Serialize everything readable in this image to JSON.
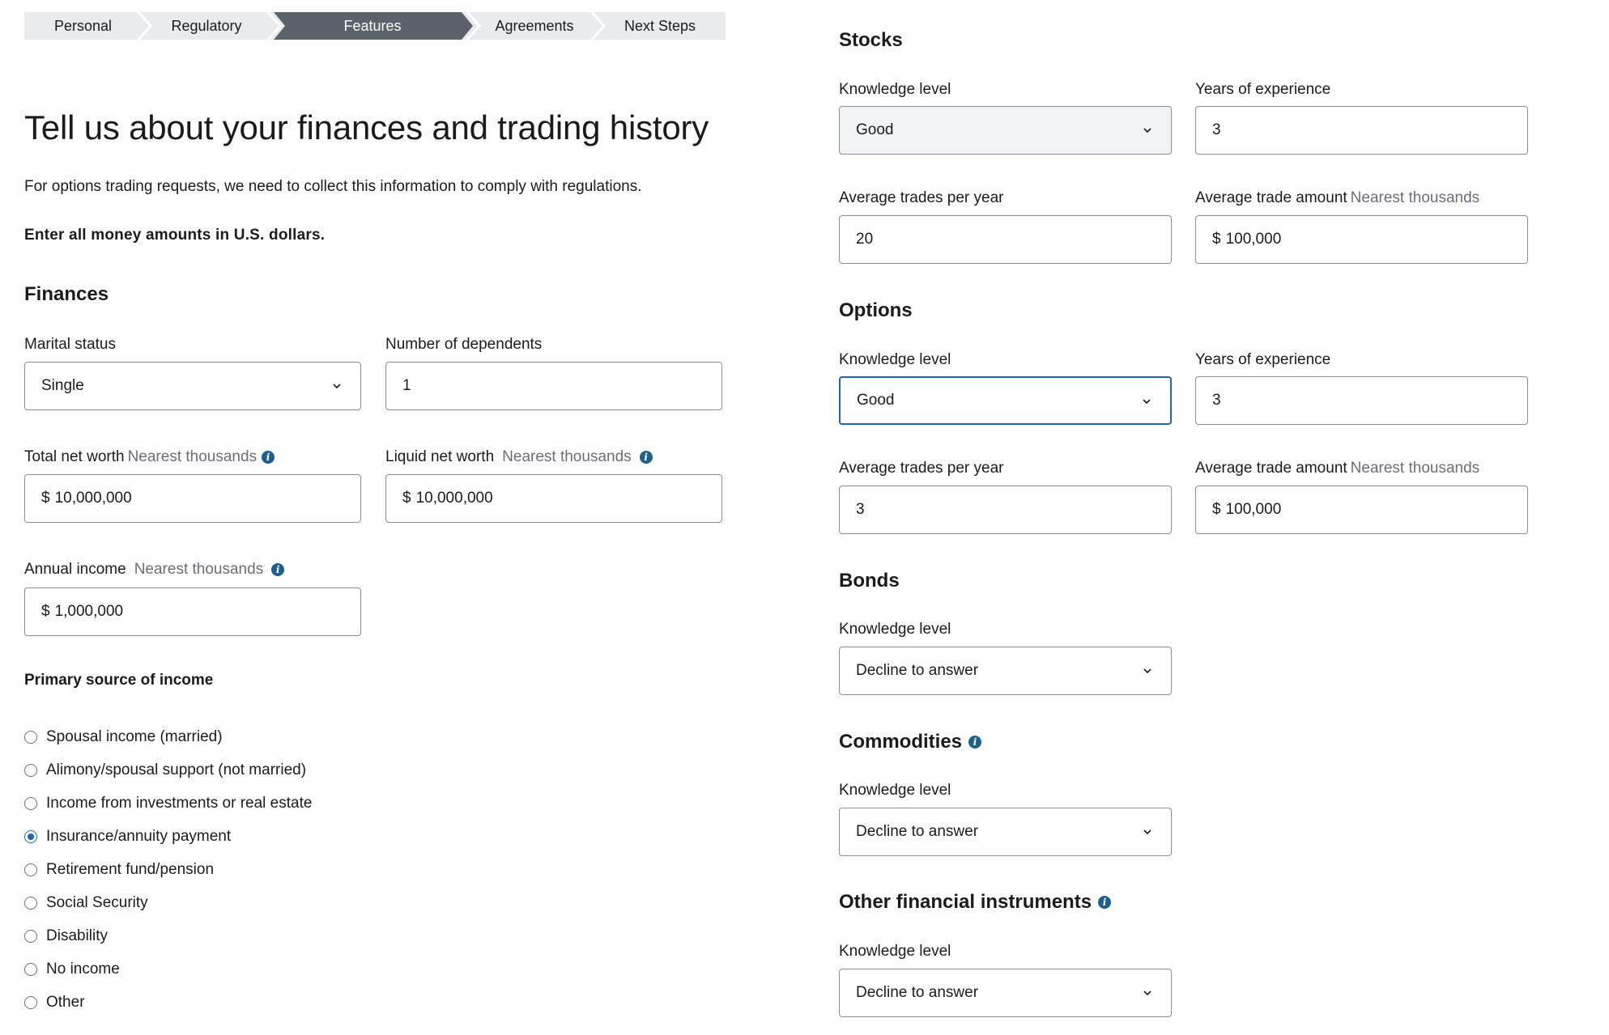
{
  "stepper": {
    "steps": [
      "Personal",
      "Regulatory",
      "Features",
      "Agreements",
      "Next Steps"
    ],
    "active_index": 2
  },
  "page": {
    "title": "Tell us about your finances and trading history",
    "intro": "For options trading requests, we need to collect this information to comply with regulations.",
    "currency_note": "Enter all money amounts in U.S. dollars."
  },
  "finances": {
    "heading": "Finances",
    "marital_status": {
      "label": "Marital status",
      "value": "Single"
    },
    "dependents": {
      "label": "Number of dependents",
      "value": "1"
    },
    "total_net_worth": {
      "label": "Total net worth",
      "hint": "Nearest thousands",
      "prefix": "$",
      "value": "10,000,000"
    },
    "liquid_net_worth": {
      "label": "Liquid net worth",
      "hint": "Nearest thousands",
      "prefix": "$",
      "value": "10,000,000"
    },
    "annual_income": {
      "label": "Annual income",
      "hint": "Nearest thousands",
      "prefix": "$",
      "value": "1,000,000"
    },
    "income_source": {
      "heading": "Primary source of income",
      "options": [
        "Spousal income (married)",
        "Alimony/spousal support (not married)",
        "Income from investments or real estate",
        "Insurance/annuity payment",
        "Retirement fund/pension",
        "Social Security",
        "Disability",
        "No income",
        "Other"
      ],
      "selected_index": 3
    }
  },
  "stocks": {
    "heading": "Stocks",
    "knowledge": {
      "label": "Knowledge level",
      "value": "Good"
    },
    "years": {
      "label": "Years of experience",
      "value": "3"
    },
    "trades": {
      "label": "Average trades per year",
      "value": "20"
    },
    "amount": {
      "label": "Average trade amount",
      "hint": "Nearest thousands",
      "prefix": "$",
      "value": "100,000"
    }
  },
  "options": {
    "heading": "Options",
    "knowledge": {
      "label": "Knowledge level",
      "value": "Good"
    },
    "years": {
      "label": "Years of experience",
      "value": "3"
    },
    "trades": {
      "label": "Average trades per year",
      "value": "3"
    },
    "amount": {
      "label": "Average trade amount",
      "hint": "Nearest thousands",
      "prefix": "$",
      "value": "100,000"
    }
  },
  "bonds": {
    "heading": "Bonds",
    "knowledge": {
      "label": "Knowledge level",
      "value": "Decline to answer"
    }
  },
  "commodities": {
    "heading": "Commodities",
    "knowledge": {
      "label": "Knowledge level",
      "value": "Decline to answer"
    }
  },
  "other_instruments": {
    "heading": "Other financial instruments",
    "knowledge": {
      "label": "Knowledge level",
      "value": "Decline to answer"
    }
  },
  "colors": {
    "stepper_bg": "#e9ebee",
    "stepper_active": "#5a636c",
    "focus_blue": "#2266a8",
    "info_icon": "#1f5f8b"
  },
  "icons": {
    "info": "i"
  }
}
